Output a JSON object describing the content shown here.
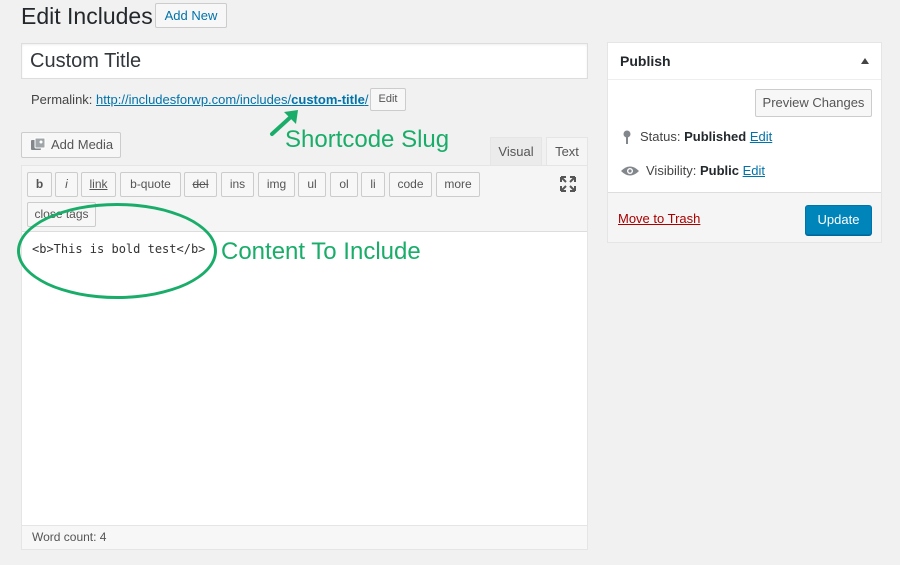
{
  "header": {
    "title": "Edit Includes",
    "add_new_label": "Add New"
  },
  "post": {
    "title_value": "Custom Title",
    "permalink_label": "Permalink:",
    "permalink_base": "http://includesforwp.com/includes/",
    "permalink_slug": "custom-title",
    "permalink_trailing": "/",
    "permalink_edit_label": "Edit"
  },
  "editor": {
    "add_media_label": "Add Media",
    "tabs": [
      {
        "label": "Visual"
      },
      {
        "label": "Text"
      }
    ],
    "active_tab": "Text",
    "quicktags": [
      {
        "label": "b"
      },
      {
        "label": "i"
      },
      {
        "label": "link"
      },
      {
        "label": "b-quote"
      },
      {
        "label": "del"
      },
      {
        "label": "ins"
      },
      {
        "label": "img"
      },
      {
        "label": "ul"
      },
      {
        "label": "ol"
      },
      {
        "label": "li"
      },
      {
        "label": "code"
      },
      {
        "label": "more"
      },
      {
        "label": "close tags"
      }
    ],
    "content": "<b>This is bold test</b>",
    "word_count": "Word count: 4"
  },
  "annotations": {
    "slug_label": "Shortcode Slug",
    "content_label": "Content To Include",
    "color": "#1aad6a"
  },
  "publish": {
    "title": "Publish",
    "preview_label": "Preview Changes",
    "status_label": "Status:",
    "status_value": "Published",
    "status_edit": "Edit",
    "visibility_label": "Visibility:",
    "visibility_value": "Public",
    "visibility_edit": "Edit",
    "trash_label": "Move to Trash",
    "update_label": "Update"
  },
  "icons": {
    "add_media": "media-icon",
    "fullscreen": "fullscreen-icon",
    "status": "pin-icon",
    "visibility": "eye-icon",
    "toggle": "triangle-up-icon"
  },
  "colors": {
    "primary": "#0085ba",
    "link": "#0073aa",
    "trash": "#aa0000"
  }
}
